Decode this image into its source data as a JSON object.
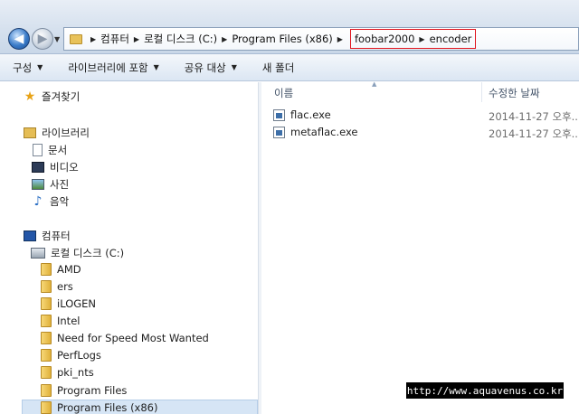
{
  "address_bar": {
    "breadcrumbs": [
      "컴퓨터",
      "로컬 디스크 (C:)",
      "Program Files (x86)"
    ],
    "highlighted_breadcrumbs": [
      "foobar2000",
      "encoder"
    ]
  },
  "toolbar": {
    "organize_label": "구성",
    "include_library_label": "라이브러리에 포함",
    "share_label": "공유 대상",
    "new_folder_label": "새 폴더"
  },
  "navigation": {
    "favorites_label": "즐겨찾기",
    "libraries_label": "라이브러리",
    "libraries": [
      "문서",
      "비디오",
      "사진",
      "음악"
    ],
    "computer_label": "컴퓨터",
    "drive_label": "로컬 디스크 (C:)",
    "folders": [
      "AMD",
      "ers",
      "iLOGEN",
      "Intel",
      "Need for Speed Most Wanted",
      "PerfLogs",
      "pki_nts",
      "Program Files",
      "Program Files (x86)"
    ]
  },
  "content": {
    "columns": {
      "name": "이름",
      "date_modified": "수정한 날짜"
    },
    "files": [
      {
        "name": "flac.exe",
        "date": "2014-11-27 오후..."
      },
      {
        "name": "metaflac.exe",
        "date": "2014-11-27 오후..."
      }
    ]
  },
  "watermark": "http://www.aquavenus.co.kr"
}
